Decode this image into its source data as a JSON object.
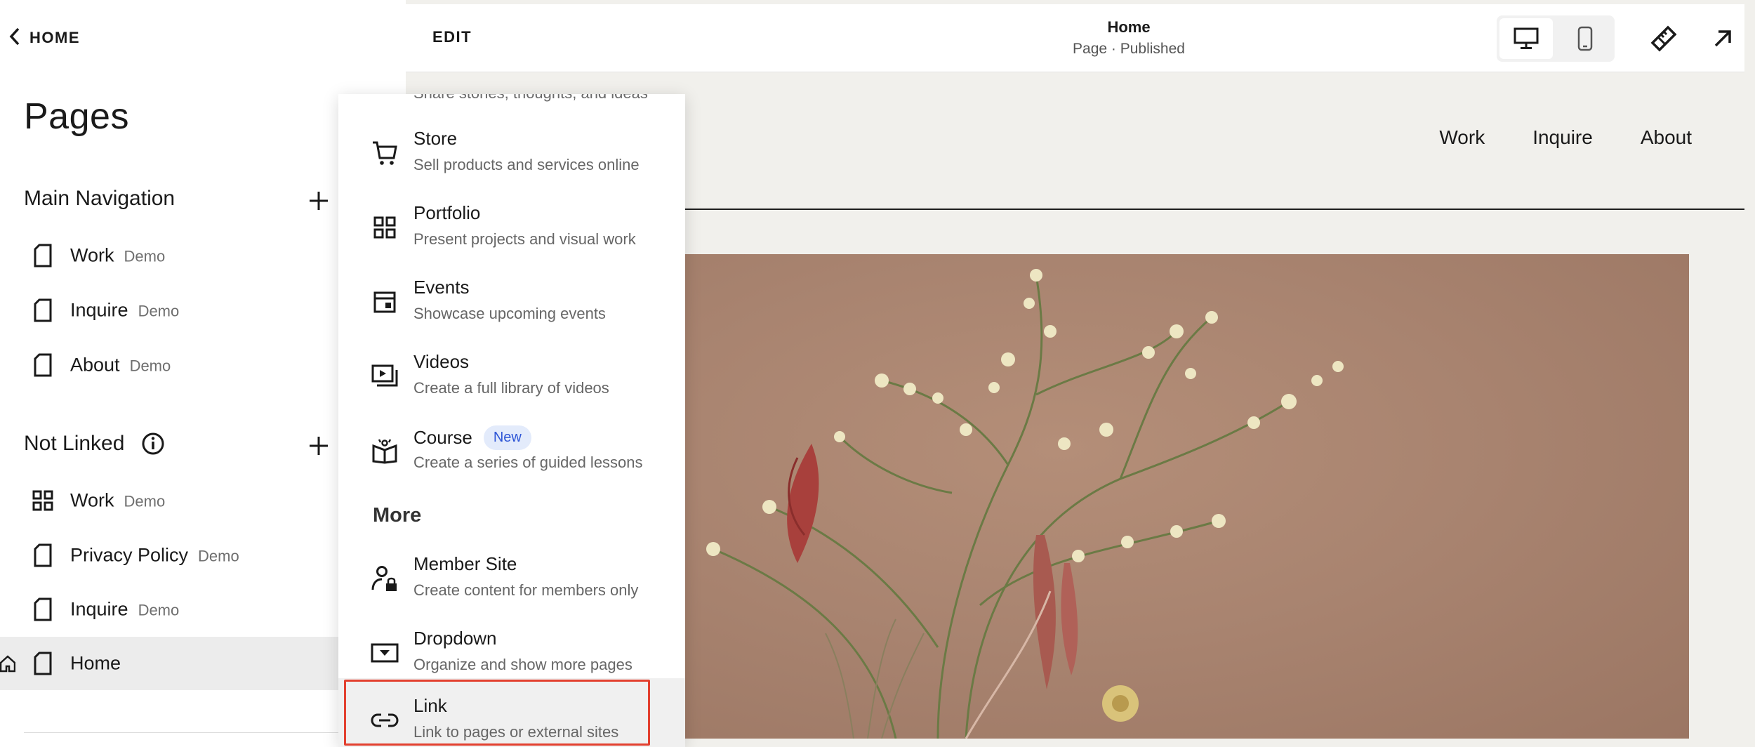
{
  "sidebar": {
    "back_label": "HOME",
    "title": "Pages",
    "main_navigation": {
      "label": "Main Navigation",
      "items": [
        {
          "label": "Work",
          "tag": "Demo"
        },
        {
          "label": "Inquire",
          "tag": "Demo"
        },
        {
          "label": "About",
          "tag": "Demo"
        }
      ]
    },
    "not_linked": {
      "label": "Not Linked",
      "items": [
        {
          "label": "Work",
          "tag": "Demo",
          "icon": "grid-icon"
        },
        {
          "label": "Privacy Policy",
          "tag": "Demo",
          "icon": "page-icon"
        },
        {
          "label": "Inquire",
          "tag": "Demo",
          "icon": "page-icon"
        },
        {
          "label": "Home",
          "tag": "",
          "icon": "page-icon",
          "active": true
        }
      ]
    }
  },
  "preview": {
    "edit_label": "EDIT",
    "page_title": "Home",
    "page_status": "Page · Published",
    "site_nav": [
      "Work",
      "Inquire",
      "About"
    ]
  },
  "menu": {
    "cutoff_desc": "Share stories, thoughts, and ideas",
    "options": [
      {
        "title": "Store",
        "desc": "Sell products and services online",
        "icon": "cart-icon"
      },
      {
        "title": "Portfolio",
        "desc": "Present projects and visual work",
        "icon": "grid-icon"
      },
      {
        "title": "Events",
        "desc": "Showcase upcoming events",
        "icon": "calendar-icon"
      },
      {
        "title": "Videos",
        "desc": "Create a full library of videos",
        "icon": "video-icon"
      },
      {
        "title": "Course",
        "desc": "Create a series of guided lessons",
        "icon": "course-icon",
        "badge": "New"
      }
    ],
    "more_heading": "More",
    "more_options": [
      {
        "title": "Member Site",
        "desc": "Create content for members only",
        "icon": "member-lock-icon"
      },
      {
        "title": "Dropdown",
        "desc": "Organize and show more pages",
        "icon": "dropdown-icon"
      },
      {
        "title": "Link",
        "desc": "Link to pages or external sites",
        "icon": "link-icon",
        "highlighted": true
      }
    ]
  },
  "colors": {
    "highlight_border": "#e3402f",
    "badge_text": "#2e56d6",
    "badge_bg": "#e3ebfb",
    "active_row": "#ececec",
    "preview_bg": "#f1f0ec"
  }
}
